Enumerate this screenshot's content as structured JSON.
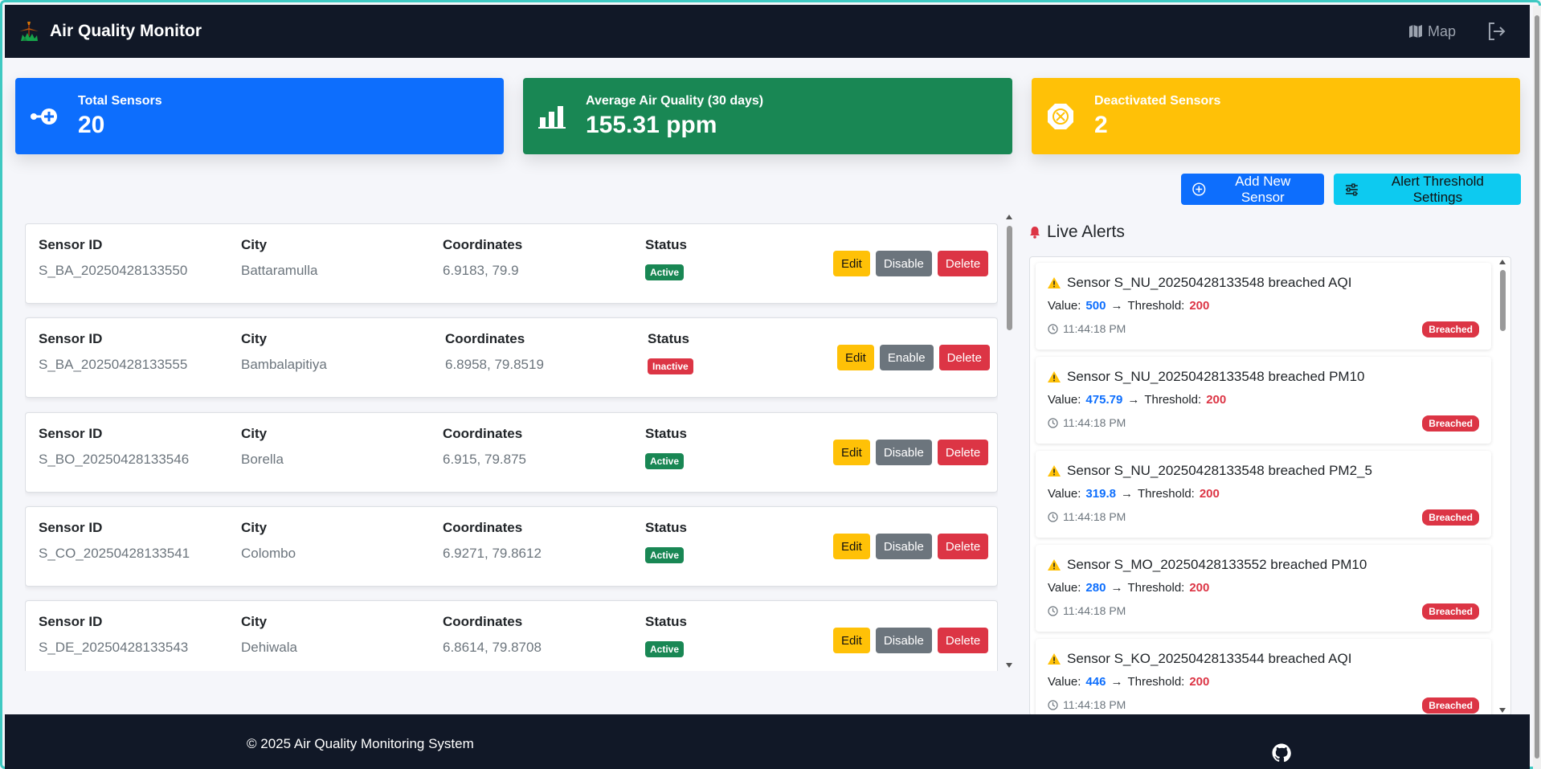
{
  "navbar": {
    "title": "Air Quality Monitor",
    "map_label": "Map"
  },
  "stats": {
    "total_sensors": {
      "label": "Total Sensors",
      "value": "20"
    },
    "average_air_quality": {
      "label": "Average Air Quality (30 days)",
      "value": "155.31 ppm"
    },
    "deactivated_sensors": {
      "label": "Deactivated Sensors",
      "value": "2"
    }
  },
  "actions": {
    "add_sensor": "Add New Sensor",
    "alert_settings": "Alert Threshold Settings"
  },
  "sensor_columns": {
    "id": "Sensor ID",
    "city": "City",
    "coords": "Coordinates",
    "status": "Status"
  },
  "sensors": [
    {
      "id": "S_BA_20250428133550",
      "city": "Battaramulla",
      "coords": "6.9183, 79.9",
      "status": "Active",
      "toggle": "Disable"
    },
    {
      "id": "S_BA_20250428133555",
      "city": "Bambalapitiya",
      "coords": "6.8958, 79.8519",
      "status": "Inactive",
      "toggle": "Enable"
    },
    {
      "id": "S_BO_20250428133546",
      "city": "Borella",
      "coords": "6.915, 79.875",
      "status": "Active",
      "toggle": "Disable"
    },
    {
      "id": "S_CO_20250428133541",
      "city": "Colombo",
      "coords": "6.9271, 79.8612",
      "status": "Active",
      "toggle": "Disable"
    },
    {
      "id": "S_DE_20250428133543",
      "city": "Dehiwala",
      "coords": "6.8614, 79.8708",
      "status": "Active",
      "toggle": "Disable"
    }
  ],
  "row_buttons": {
    "edit": "Edit",
    "delete": "Delete"
  },
  "alerts": {
    "title": "Live Alerts",
    "value_label": "Value:",
    "threshold_label": "Threshold:",
    "items": [
      {
        "text": "Sensor S_NU_20250428133548 breached AQI",
        "value": "500",
        "threshold": "200",
        "time": "11:44:18 PM",
        "status": "Breached"
      },
      {
        "text": "Sensor S_NU_20250428133548 breached PM10",
        "value": "475.79",
        "threshold": "200",
        "time": "11:44:18 PM",
        "status": "Breached"
      },
      {
        "text": "Sensor S_NU_20250428133548 breached PM2_5",
        "value": "319.8",
        "threshold": "200",
        "time": "11:44:18 PM",
        "status": "Breached"
      },
      {
        "text": "Sensor S_MO_20250428133552 breached PM10",
        "value": "280",
        "threshold": "200",
        "time": "11:44:18 PM",
        "status": "Breached"
      },
      {
        "text": "Sensor S_KO_20250428133544 breached AQI",
        "value": "446",
        "threshold": "200",
        "time": "11:44:18 PM",
        "status": "Breached"
      }
    ]
  },
  "footer": {
    "copyright": "© 2025 Air Quality Monitoring System"
  },
  "colors": {
    "primary": "#0d6efd",
    "success": "#198754",
    "warning": "#ffc107",
    "danger": "#dc3545",
    "info": "#0dcaf0",
    "navbar": "#111827"
  }
}
